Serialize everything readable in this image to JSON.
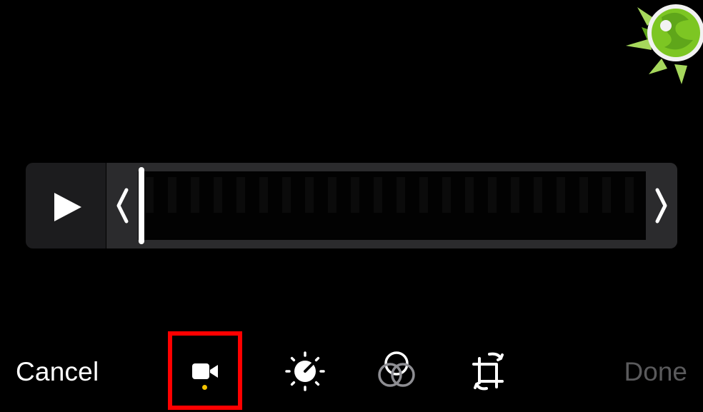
{
  "toolbar": {
    "cancel_label": "Cancel",
    "done_label": "Done",
    "tools": [
      {
        "name": "video",
        "icon": "video-camera-icon",
        "selected": true
      },
      {
        "name": "adjust",
        "icon": "adjust-dial-icon",
        "selected": false
      },
      {
        "name": "filters",
        "icon": "filters-circles-icon",
        "selected": false
      },
      {
        "name": "crop",
        "icon": "crop-rotate-icon",
        "selected": false
      }
    ]
  },
  "timeline": {
    "play_icon": "play-icon",
    "trim_left_icon": "chevron-left-icon",
    "trim_right_icon": "chevron-right-icon"
  },
  "colors": {
    "background": "#000000",
    "timeline_bg": "#1c1c1e",
    "highlight": "#ff0000",
    "selected_dot": "#f5c400",
    "done_disabled": "#5a5a5c",
    "logo_green": "#7dc623"
  }
}
